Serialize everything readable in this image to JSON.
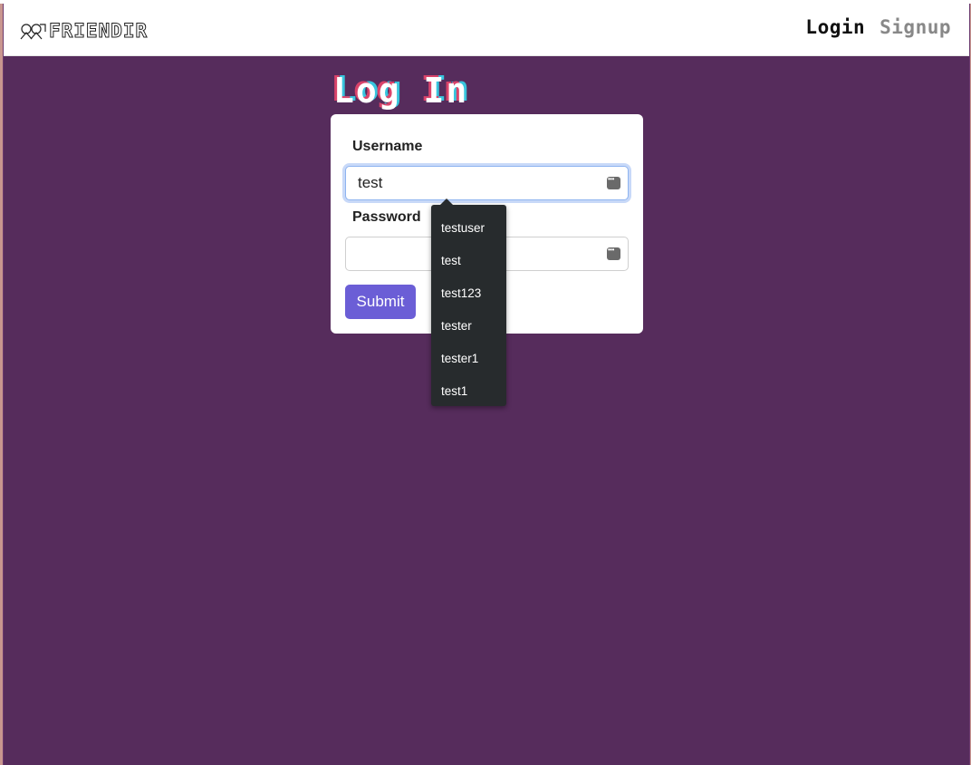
{
  "navbar": {
    "brand": "FRIENDIR",
    "login_label": "Login",
    "signup_label": "Signup"
  },
  "page": {
    "title": "Log In"
  },
  "form": {
    "username_label": "Username",
    "username_value": "test",
    "password_label": "Password",
    "password_value": "",
    "submit_label": "Submit"
  },
  "autocomplete": {
    "items": [
      "testuser",
      "test",
      "test123",
      "tester",
      "tester1",
      "test1"
    ]
  },
  "colors": {
    "background": "#562c5c",
    "submit": "#6b5ed6",
    "autocomplete_bg": "#272b2d"
  },
  "icons": {
    "brand": "puzzle-logo-icon",
    "password_manager": "password-manager-icon"
  }
}
